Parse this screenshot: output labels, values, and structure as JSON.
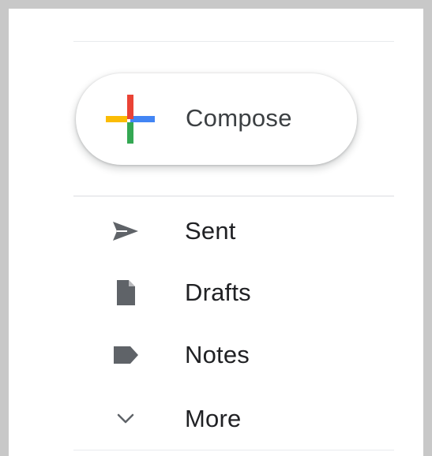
{
  "compose": {
    "label": "Compose",
    "icon": "plus-multicolor-icon",
    "colors": {
      "red": "#ea4335",
      "blue": "#4285f4",
      "green": "#34a853",
      "yellow": "#fbbc04"
    }
  },
  "nav": {
    "items": [
      {
        "label": "Sent",
        "icon": "send-icon"
      },
      {
        "label": "Drafts",
        "icon": "draft-file-icon"
      },
      {
        "label": "Notes",
        "icon": "label-tag-icon"
      },
      {
        "label": "More",
        "icon": "chevron-down-icon"
      }
    ]
  },
  "colors": {
    "icon_gray": "#5f6368",
    "text": "#202124",
    "frame_border": "#c8c8c8",
    "divider": "#e8eaed"
  }
}
